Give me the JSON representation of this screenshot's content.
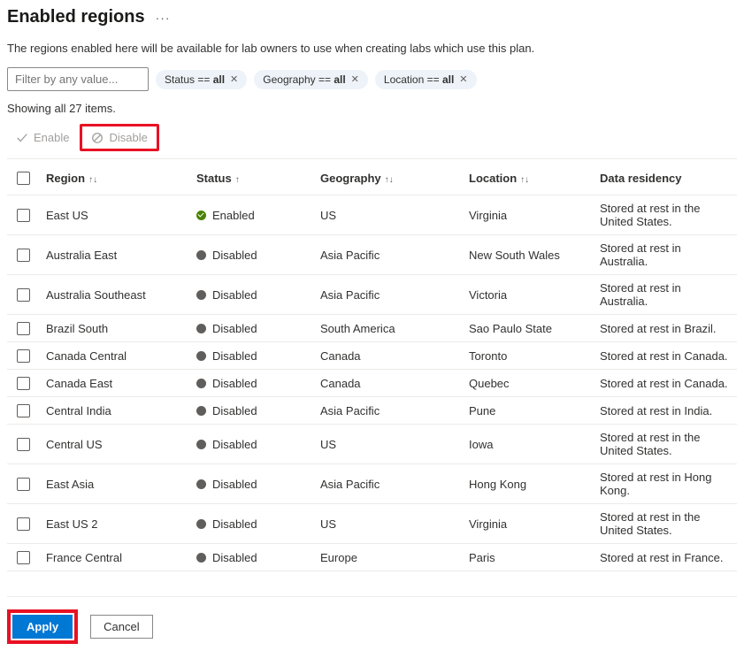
{
  "header": {
    "title": "Enabled regions"
  },
  "description": "The regions enabled here will be available for lab owners to use when creating labs which use this plan.",
  "filter": {
    "placeholder": "Filter by any value...",
    "pills": [
      {
        "key": "Status",
        "op": "==",
        "value": "all"
      },
      {
        "key": "Geography",
        "op": "==",
        "value": "all"
      },
      {
        "key": "Location",
        "op": "==",
        "value": "all"
      }
    ]
  },
  "itemsCount": "Showing all 27 items.",
  "actions": {
    "enable": "Enable",
    "disable": "Disable"
  },
  "table": {
    "headers": {
      "region": "Region",
      "status": "Status",
      "geography": "Geography",
      "location": "Location",
      "residency": "Data residency"
    },
    "rows": [
      {
        "region": "East US",
        "status": "Enabled",
        "geography": "US",
        "location": "Virginia",
        "residency": "Stored at rest in the United States."
      },
      {
        "region": "Australia East",
        "status": "Disabled",
        "geography": "Asia Pacific",
        "location": "New South Wales",
        "residency": "Stored at rest in Australia."
      },
      {
        "region": "Australia Southeast",
        "status": "Disabled",
        "geography": "Asia Pacific",
        "location": "Victoria",
        "residency": "Stored at rest in Australia."
      },
      {
        "region": "Brazil South",
        "status": "Disabled",
        "geography": "South America",
        "location": "Sao Paulo State",
        "residency": "Stored at rest in Brazil."
      },
      {
        "region": "Canada Central",
        "status": "Disabled",
        "geography": "Canada",
        "location": "Toronto",
        "residency": "Stored at rest in Canada."
      },
      {
        "region": "Canada East",
        "status": "Disabled",
        "geography": "Canada",
        "location": "Quebec",
        "residency": "Stored at rest in Canada."
      },
      {
        "region": "Central India",
        "status": "Disabled",
        "geography": "Asia Pacific",
        "location": "Pune",
        "residency": "Stored at rest in India."
      },
      {
        "region": "Central US",
        "status": "Disabled",
        "geography": "US",
        "location": "Iowa",
        "residency": "Stored at rest in the United States."
      },
      {
        "region": "East Asia",
        "status": "Disabled",
        "geography": "Asia Pacific",
        "location": "Hong Kong",
        "residency": "Stored at rest in Hong Kong."
      },
      {
        "region": "East US 2",
        "status": "Disabled",
        "geography": "US",
        "location": "Virginia",
        "residency": "Stored at rest in the United States."
      },
      {
        "region": "France Central",
        "status": "Disabled",
        "geography": "Europe",
        "location": "Paris",
        "residency": "Stored at rest in France."
      }
    ]
  },
  "footer": {
    "apply": "Apply",
    "cancel": "Cancel"
  }
}
